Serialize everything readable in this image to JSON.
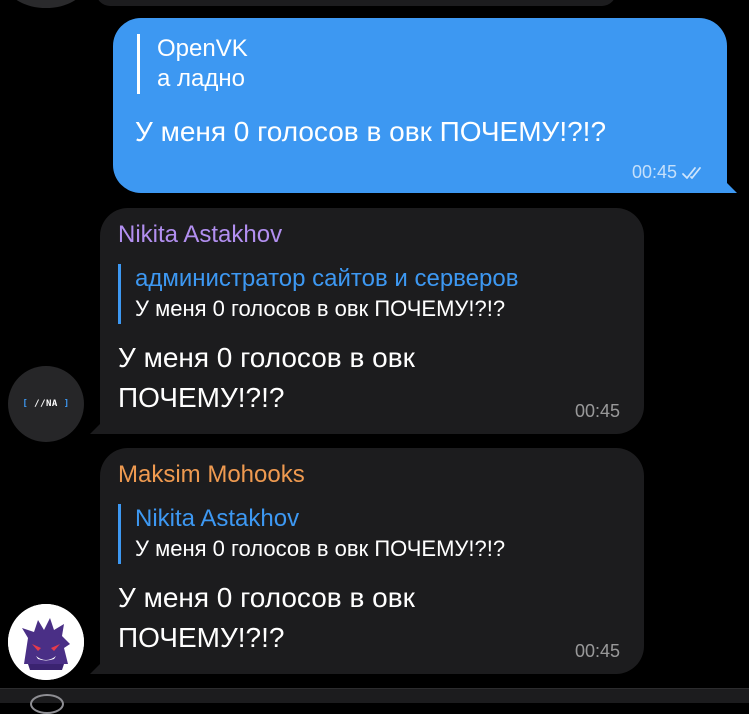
{
  "outgoing": {
    "reply": {
      "author": "OpenVK",
      "text": "а ладно"
    },
    "text": "У меня 0 голосов в овк ПОЧЕМУ!?!?",
    "time": "00:45",
    "status_icon": "double-check-icon"
  },
  "messages": [
    {
      "sender": "Nikita Astakhov",
      "reply": {
        "author": "администратор сайтов и серверов",
        "text": "У меня 0 голосов в овк ПОЧЕМУ!?!?"
      },
      "text": "У меня 0 голосов в овк ПОЧЕМУ!?!?",
      "time": "00:45",
      "avatar": {
        "text": "//NA",
        "bracket_left": "[",
        "bracket_right": "]"
      }
    },
    {
      "sender": "Maksim Mohooks",
      "reply": {
        "author": "Nikita Astakhov",
        "text": "У меня 0 голосов в овк ПОЧЕМУ!?!?"
      },
      "text": "У меня 0 голосов в овк ПОЧЕМУ!?!?",
      "time": "00:45",
      "avatar": {
        "icon": "gengar-avatar-icon"
      }
    }
  ],
  "colors": {
    "outgoing_bubble": "#3d98f2",
    "incoming_bubble": "#1c1c1e",
    "sender_nikita": "#b28ff0",
    "sender_maksim": "#ef9a50",
    "reply_accent": "#3d98f2",
    "background": "#000000"
  }
}
